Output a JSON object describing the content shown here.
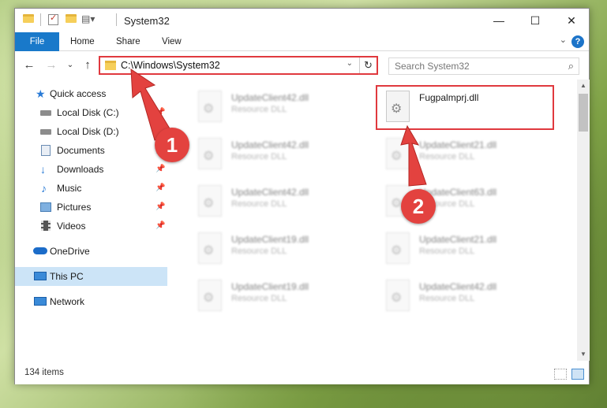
{
  "window": {
    "title": "System32",
    "controls": {
      "minimize": "—",
      "maximize": "☐",
      "close": "✕"
    }
  },
  "ribbon": {
    "tabs": [
      {
        "label": "File"
      },
      {
        "label": "Home"
      },
      {
        "label": "Share"
      },
      {
        "label": "View"
      }
    ],
    "help": "?",
    "expand": "⌄"
  },
  "navigation": {
    "back": "←",
    "forward": "→",
    "recent": "⌄",
    "up": "↑",
    "address": "C:\\Windows\\System32",
    "address_dropdown": "⌄",
    "refresh": "↻",
    "search_placeholder": "Search System32",
    "search_icon": "⌕"
  },
  "sidebar": {
    "pin_glyph": "📌",
    "items": [
      {
        "label": "Quick access",
        "icon": "star-icon"
      },
      {
        "label": "Local Disk (C:)",
        "icon": "drive-icon"
      },
      {
        "label": "Local Disk (D:)",
        "icon": "drive-icon"
      },
      {
        "label": "Documents",
        "icon": "documents-icon"
      },
      {
        "label": "Downloads",
        "icon": "download-icon"
      },
      {
        "label": "Music",
        "icon": "music-icon"
      },
      {
        "label": "Pictures",
        "icon": "pictures-icon"
      },
      {
        "label": "Videos",
        "icon": "videos-icon"
      },
      {
        "label": "OneDrive",
        "icon": "cloud-icon"
      },
      {
        "label": "This PC",
        "icon": "computer-icon",
        "selected": true
      },
      {
        "label": "Network",
        "icon": "network-icon"
      }
    ]
  },
  "files": [
    {
      "name": "UpdateClient42.dll",
      "type": "Resource DLL"
    },
    {
      "name": "Fugpalmprj.dll",
      "type": ""
    },
    {
      "name": "UpdateClient42.dll",
      "type": "Resource DLL"
    },
    {
      "name": "UpdateClient21.dll",
      "type": "Resource DLL"
    },
    {
      "name": "UpdateClient42.dll",
      "type": "Resource DLL"
    },
    {
      "name": "UpdateClient63.dll",
      "type": "Resource DLL"
    },
    {
      "name": "UpdateClient19.dll",
      "type": "Resource DLL"
    },
    {
      "name": "UpdateClient21.dll",
      "type": "Resource DLL"
    },
    {
      "name": "UpdateClient19.dll",
      "type": "Resource DLL"
    },
    {
      "name": "UpdateClient42.dll",
      "type": "Resource DLL"
    }
  ],
  "status": {
    "item_count": "134 items"
  },
  "annotations": {
    "step1": "1",
    "step2": "2",
    "accent_color": "#e3423f"
  }
}
